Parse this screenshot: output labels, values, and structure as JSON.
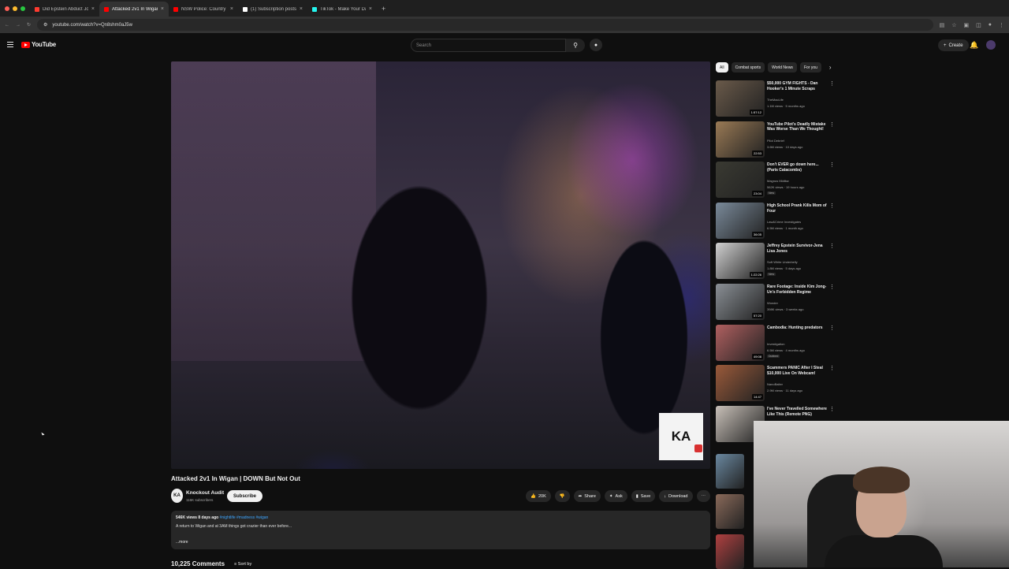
{
  "browser": {
    "tabs": [
      {
        "label": "Did Epstein Abduct JonBenét",
        "favicon_color": "#ff3b30",
        "active": false
      },
      {
        "label": "Attacked 2v1 In Wigan | D",
        "favicon_color": "#ff0000",
        "active": true
      },
      {
        "label": "NSW Police: Country Cop vs",
        "favicon_color": "#ff0000",
        "active": false
      },
      {
        "label": "(1) Subscription posts by W",
        "favicon_color": "#ffffff",
        "active": false
      },
      {
        "label": "TikTok - Make Your Day",
        "favicon_color": "#25f4ee",
        "active": false
      }
    ],
    "new_tab": "+",
    "url": "youtube.com/watch?v=Qn8shm0aJ5w"
  },
  "masthead": {
    "logo_text": "YouTube",
    "search_placeholder": "Search",
    "create_label": "Create"
  },
  "video": {
    "title": "Attacked 2v1 In Wigan | DOWN But Not Out",
    "channel_name": "Knockout Audit",
    "channel_avatar": "KA",
    "subscribers": "116K subscribers",
    "subscribe_label": "Subscribe",
    "likes": "20K",
    "share_label": "Share",
    "ask_label": "Ask",
    "save_label": "Save",
    "download_label": "Download",
    "overlay_logo": "KA",
    "description_meta": "546K views  8 days ago",
    "description_tags": "#nightlife #madness #wigan",
    "description_text": "A return to Wigan and at 3AM things got crazier than ever before...",
    "more_label": "...more",
    "comments_count": "10,225 Comments",
    "sort_label": "Sort by"
  },
  "chips": [
    "All",
    "Combat sports",
    "World News",
    "For you"
  ],
  "recommendations": [
    {
      "title": "$50,000 GYM FIGHTS - Dan Hooker's 1 Minute Scraps",
      "channel": "TheMacLife",
      "views": "1.1M views · 5 months ago",
      "duration": "1:57:12",
      "badge": "",
      "thumb_color": "#6a5a4a"
    },
    {
      "title": "YouTube Pilot's Deadly Mistake Was Worse Than We Thought!",
      "channel": "Pilot Debrief",
      "views": "3.6M views · 10 days ago",
      "duration": "22:53",
      "badge": "",
      "thumb_color": "#9a7a55"
    },
    {
      "title": "Don't EVER go down here... (Paris Catacombs)",
      "channel": "Magnus Midtbø",
      "views": "562K views · 19 hours ago",
      "duration": "23:04",
      "badge": "New",
      "thumb_color": "#3a3a32"
    },
    {
      "title": "High School Prank Kills Mom of Four",
      "channel": "Law&Crime Investigates",
      "views": "6.5M views · 1 month ago",
      "duration": "36:05",
      "badge": "",
      "thumb_color": "#7a8a9a"
    },
    {
      "title": "Jeffrey Epstein Survivor-Jena Lisa Jones",
      "channel": "Soft White Underbelly",
      "views": "1.8M views · 5 days ago",
      "duration": "1:22:26",
      "badge": "New",
      "thumb_color": "#d0d0d0"
    },
    {
      "title": "Rare Footage: Inside Kim Jong-Un's Forbidden Regime",
      "channel": "Wonder",
      "views": "398K views · 3 weeks ago",
      "duration": "57:20",
      "badge": "",
      "thumb_color": "#8a8f95"
    },
    {
      "title": "Cambodia: Hunting predators",
      "channel": "Investigation",
      "views": "6.5M views · 4 months ago",
      "duration": "49:08",
      "badge": "Dubbed",
      "thumb_color": "#b06060"
    },
    {
      "title": "Scammers PANIC After I Steal $10,000 Live On Webcam!",
      "channel": "NanoBaiter",
      "views": "2.9M views · 11 days ago",
      "duration": "14:47",
      "badge": "",
      "thumb_color": "#9a5a3a"
    },
    {
      "title": "I've Never Travelled Somewhere Like This (Remote PNG)",
      "channel": "",
      "views": "",
      "duration": "",
      "badge": "",
      "thumb_color": "#c8c0b8"
    }
  ],
  "extra_thumbs": [
    {
      "thumb_color": "#6a88a0"
    },
    {
      "thumb_color": "#8a6a5a"
    },
    {
      "thumb_color": "#b04040"
    }
  ],
  "colors": {
    "background": "#0f0f0f",
    "brand_red": "#ff0000",
    "link_blue": "#3ea6ff"
  }
}
